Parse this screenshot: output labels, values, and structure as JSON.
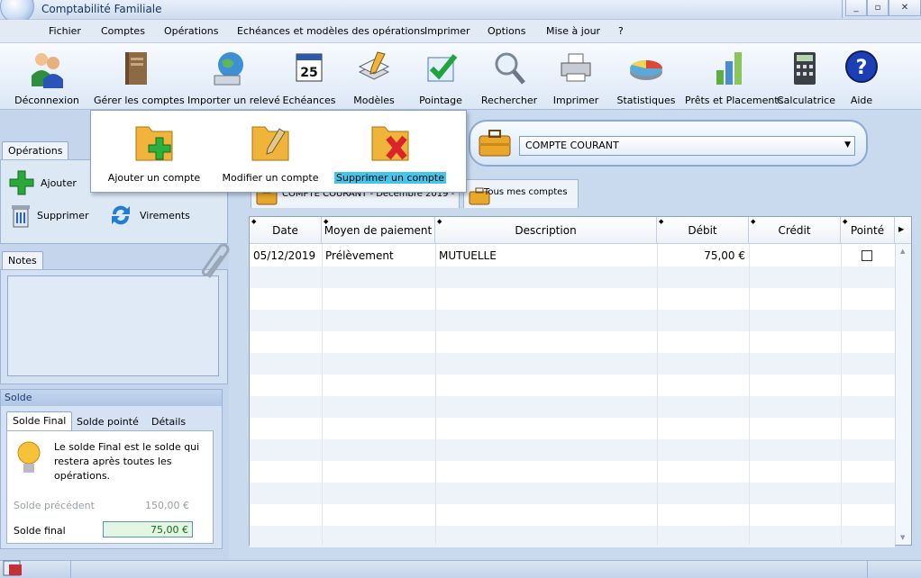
{
  "window": {
    "title": "Comptabilité Familiale",
    "controls": [
      "_",
      "▫",
      "✕"
    ]
  },
  "menu": [
    "Fichier",
    "Comptes",
    "Opérations",
    "Echéances et modèles des opérations",
    "Imprimer",
    "Options",
    "Mise à jour",
    "?"
  ],
  "toolbar": {
    "deconnexion": "Déconnexion",
    "gerer": "Gérer les comptes",
    "importer": "Importer un relevé",
    "echeances": "Echéances",
    "echeances_day": "25",
    "modeles": "Modèles",
    "pointage": "Pointage",
    "rechercher": "Rechercher",
    "imprimer": "Imprimer",
    "statistiques": "Statistiques",
    "prets": "Prêts et Placements",
    "calculatrice": "Calculatrice",
    "aide": "Aide",
    "aide_glyph": "?"
  },
  "popup": {
    "add": "Ajouter un compte",
    "edit": "Modifier un compte",
    "delete": "Supprimer un compte"
  },
  "operations": {
    "tab": "Opérations",
    "add": "Ajouter",
    "delete": "Supprimer",
    "transfers": "Virements"
  },
  "notes": {
    "tab": "Notes"
  },
  "solde": {
    "title": "Solde",
    "tabs": [
      "Solde Final",
      "Solde pointé",
      "Détails"
    ],
    "info": "Le solde Final est le solde qui restera après toutes les opérations.",
    "prev_label": "Solde précédent",
    "prev_value": "150,00 €",
    "final_label": "Solde final",
    "final_value": "75,00 €"
  },
  "account": {
    "selected": "COMPTE COURANT",
    "tab_current": "COMPTE COURANT - Décembre 2019 -",
    "tab_all": "Tous mes comptes"
  },
  "grid": {
    "columns": [
      "Date",
      "Moyen de paiement",
      "Description",
      "Débit",
      "Crédit",
      "Pointé"
    ],
    "rows": [
      {
        "date": "05/12/2019",
        "moyen": "Prélèvement",
        "description": "MUTUELLE",
        "debit": "75,00 €",
        "credit": "",
        "pointe": false
      }
    ]
  }
}
